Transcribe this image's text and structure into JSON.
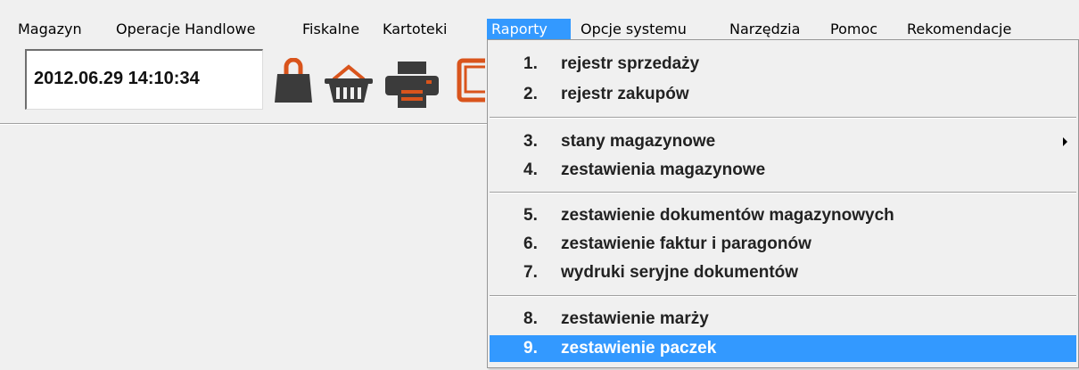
{
  "menubar": {
    "items": [
      {
        "label": "Magazyn"
      },
      {
        "label": "Operacje Handlowe"
      },
      {
        "label": "Fiskalne"
      },
      {
        "label": "Kartoteki"
      },
      {
        "label": "Raporty"
      },
      {
        "label": "Opcje systemu"
      },
      {
        "label": "Narzędzia"
      },
      {
        "label": "Pomoc"
      },
      {
        "label": "Rekomendacje"
      }
    ],
    "active": "Raporty",
    "accent_color": "#3399ff"
  },
  "toolbar": {
    "datetime": "2012.06.29 14:10:34",
    "icons": [
      "shopping-bag-icon",
      "shopping-basket-icon",
      "printer-icon",
      "monitor-icon"
    ]
  },
  "raporty_menu": {
    "items": [
      {
        "num": "1.",
        "label": "rejestr sprzedaży"
      },
      {
        "num": "2.",
        "label": "rejestr zakupów"
      },
      {
        "num": "3.",
        "label": "stany magazynowe",
        "submenu": true
      },
      {
        "num": "4.",
        "label": "zestawienia magazynowe"
      },
      {
        "num": "5.",
        "label": "zestawienie dokumentów magazynowych"
      },
      {
        "num": "6.",
        "label": "zestawienie faktur i paragonów"
      },
      {
        "num": "7.",
        "label": "wydruki seryjne dokumentów"
      },
      {
        "num": "8.",
        "label": "zestawienie marży"
      },
      {
        "num": "9.",
        "label": "zestawienie paczek",
        "selected": true
      }
    ]
  }
}
